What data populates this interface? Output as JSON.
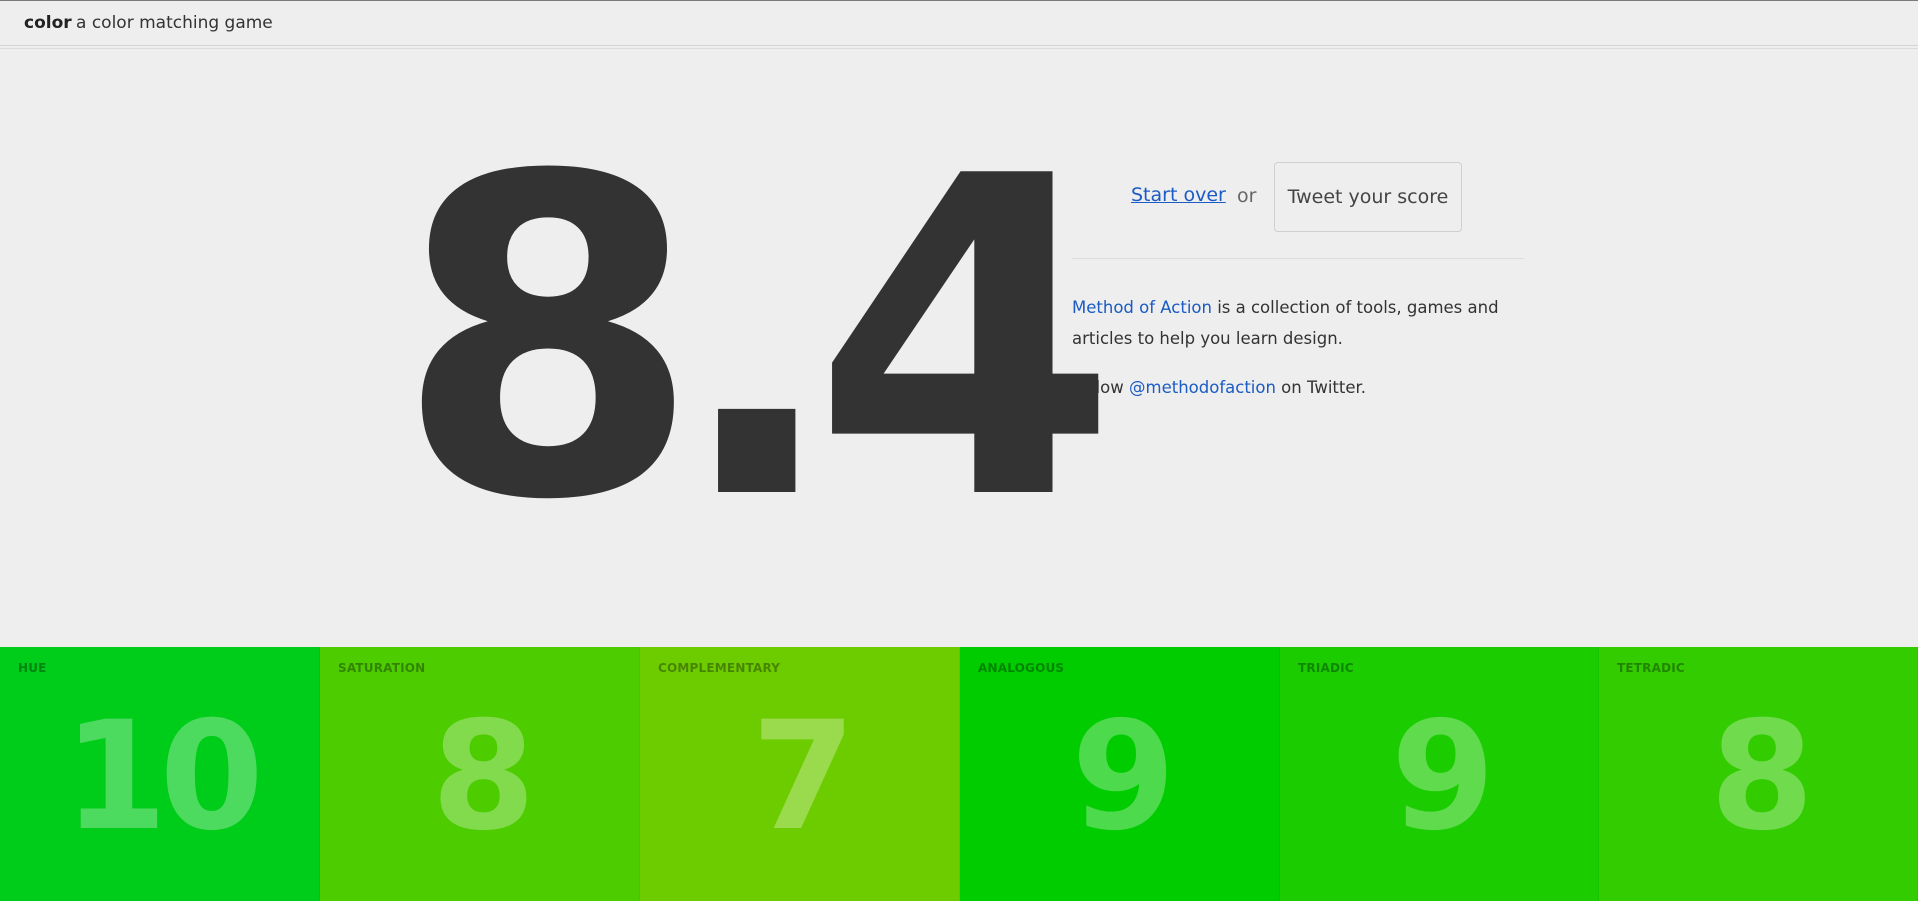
{
  "header": {
    "brand": "color",
    "tagline": "a color matching game"
  },
  "score": {
    "value": "8.4"
  },
  "actions": {
    "start_over": "Start over",
    "or": "or",
    "tweet": "Tweet your score"
  },
  "about": {
    "link_text": "Method of Action",
    "text": " is a collection of tools, games and articles to help you learn design."
  },
  "follow": {
    "prefix": "Follow ",
    "handle": "@methodofaction",
    "suffix": " on Twitter."
  },
  "tiles": [
    {
      "label": "HUE",
      "score": "10",
      "color": "#00cc1a"
    },
    {
      "label": "SATURATION",
      "score": "8",
      "color": "#4dcc00"
    },
    {
      "label": "COMPLEMENTARY",
      "score": "7",
      "color": "#6dcc00"
    },
    {
      "label": "ANALOGOUS",
      "score": "9",
      "color": "#00cc00"
    },
    {
      "label": "TRIADIC",
      "score": "9",
      "color": "#1acc00"
    },
    {
      "label": "TETRADIC",
      "score": "8",
      "color": "#33cc00"
    }
  ]
}
